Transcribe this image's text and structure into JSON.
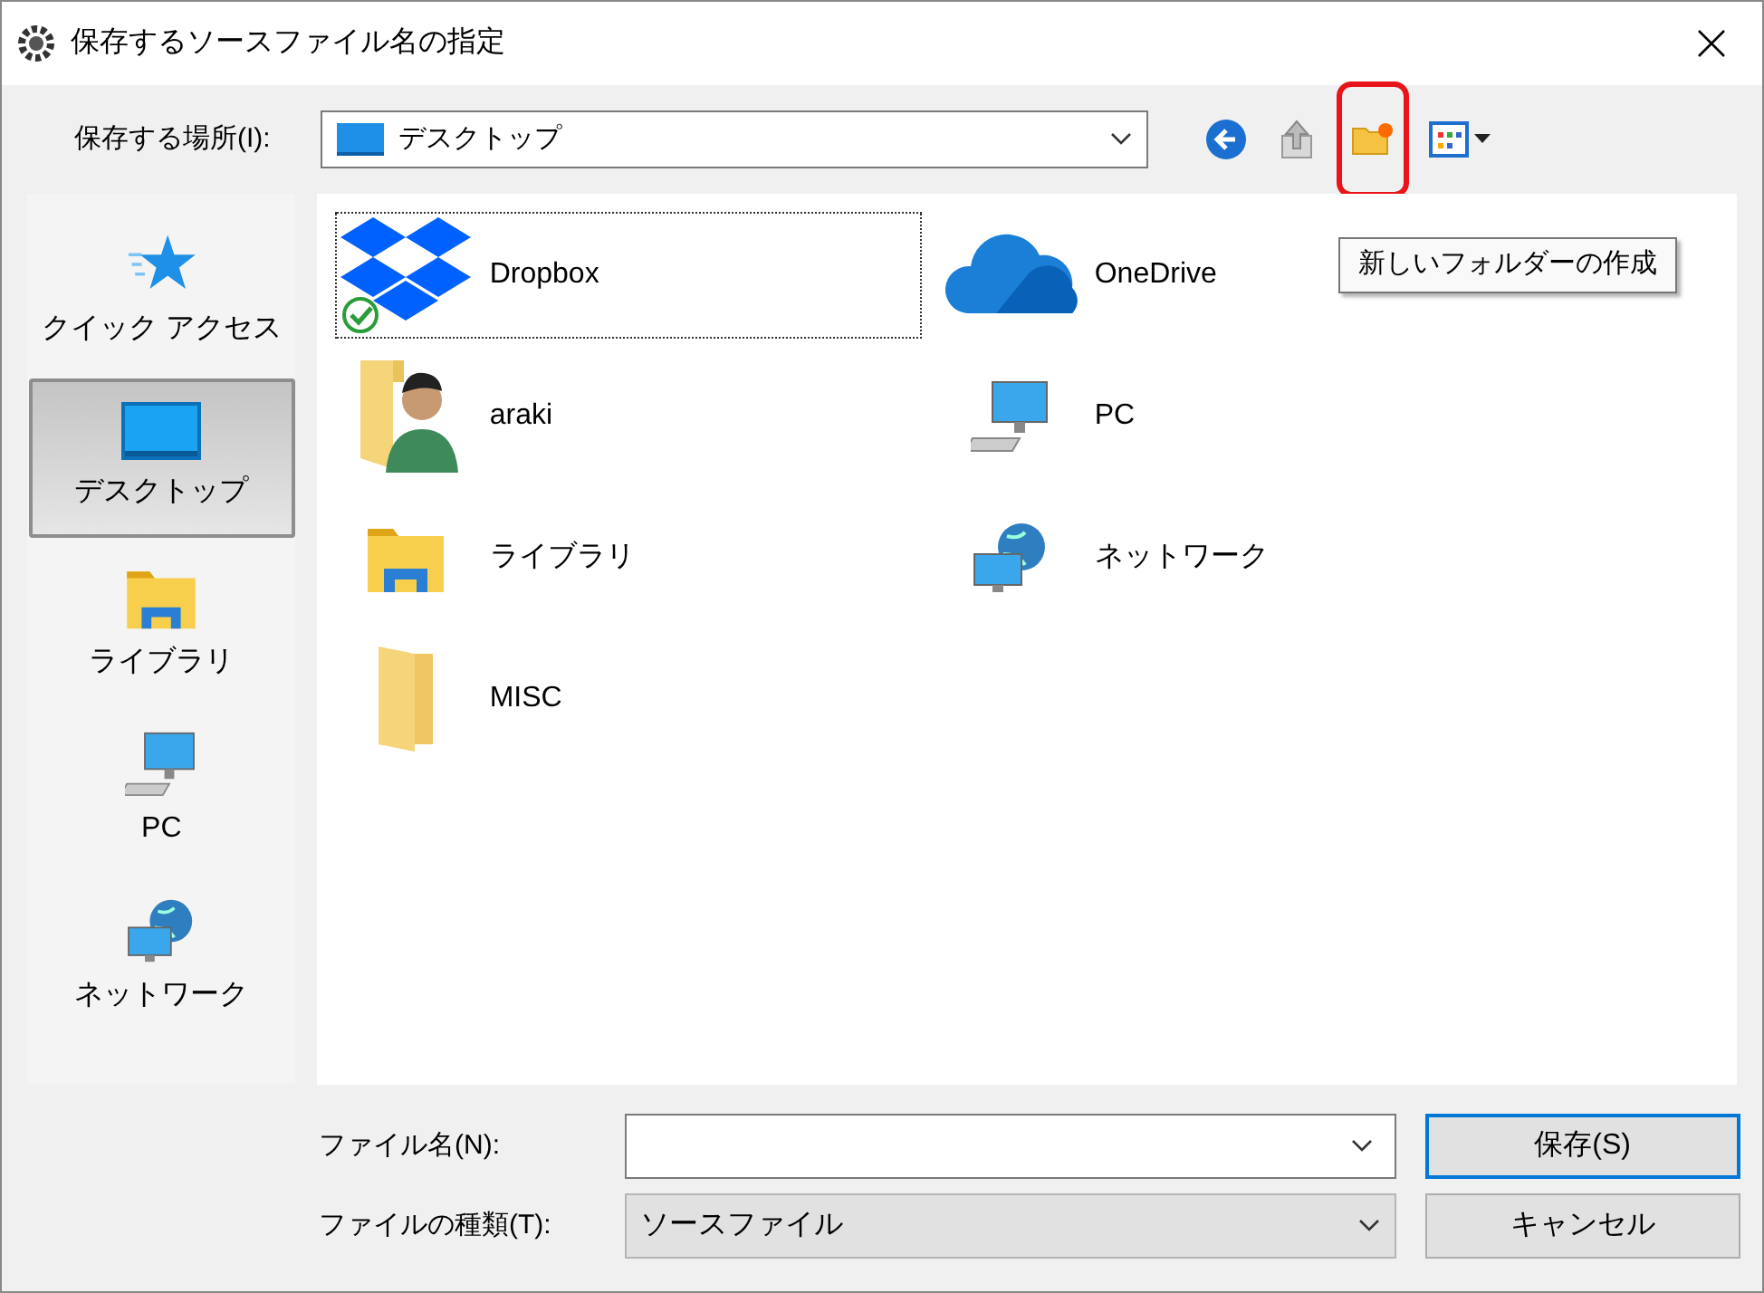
{
  "window": {
    "title": "保存するソースファイル名の指定"
  },
  "location": {
    "label": "保存する場所(I):",
    "value": "デスクトップ"
  },
  "toolbar": [
    {
      "kind": "back",
      "highlighted": false
    },
    {
      "kind": "up",
      "highlighted": false
    },
    {
      "kind": "new_folder",
      "highlighted": true
    },
    {
      "kind": "view",
      "highlighted": false
    }
  ],
  "tooltip": "新しいフォルダーの作成",
  "sidebar": [
    {
      "label": "クイック アクセス",
      "kind": "star",
      "selected": false
    },
    {
      "label": "デスクトップ",
      "kind": "desktop",
      "selected": true
    },
    {
      "label": "ライブラリ",
      "kind": "library",
      "selected": false
    },
    {
      "label": "PC",
      "kind": "pc",
      "selected": false
    },
    {
      "label": "ネットワーク",
      "kind": "network",
      "selected": false
    }
  ],
  "items": [
    {
      "name": "Dropbox",
      "kind": "dropbox",
      "focused": true
    },
    {
      "name": "OneDrive",
      "kind": "cloud",
      "focused": false
    },
    {
      "name": "araki",
      "kind": "user",
      "focused": false
    },
    {
      "name": "PC",
      "kind": "pc",
      "focused": false
    },
    {
      "name": "ライブラリ",
      "kind": "library",
      "focused": false
    },
    {
      "name": "ネットワーク",
      "kind": "network",
      "focused": false
    },
    {
      "name": "MISC",
      "kind": "folder",
      "focused": false
    }
  ],
  "file_name": {
    "label": "ファイル名(N):"
  },
  "file_type": {
    "label": "ファイルの種類(T):",
    "value": "ソースファイル"
  },
  "buttons": [
    {
      "label": "保存(S)",
      "default": true
    },
    {
      "label": "キャンセル",
      "default": false
    }
  ]
}
